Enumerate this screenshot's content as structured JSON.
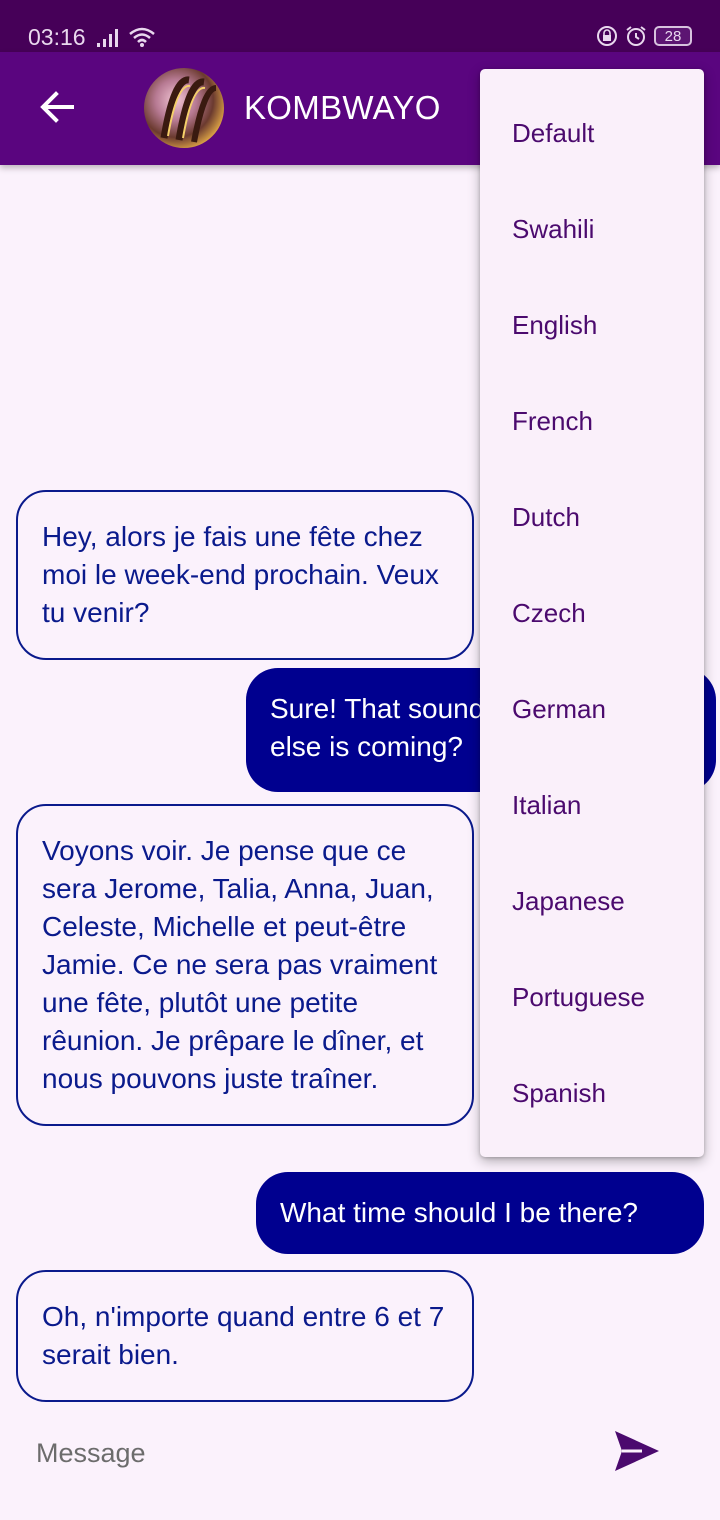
{
  "status_bar": {
    "time": "03:16",
    "battery": "28"
  },
  "header": {
    "contact_name": "KOMBWAYO"
  },
  "messages": [
    {
      "side": "incoming",
      "text": "Hey, alors je fais une fête chez moi le week-end prochain. Veux tu venir?"
    },
    {
      "side": "outgoing",
      "text": "Sure! That sounds great. Who else is coming?"
    },
    {
      "side": "incoming",
      "text": "Voyons voir. Je pense que ce sera Jerome, Talia, Anna, Juan, Celeste, Michelle et peut-être Jamie. Ce ne sera pas vraiment une fête, plutôt une petite rêunion. Je prêpare le dîner, et nous pouvons juste traîner."
    },
    {
      "side": "outgoing",
      "text": "What time should I be there?"
    },
    {
      "side": "incoming",
      "text": "Oh, n'importe quand entre 6 et 7 serait bien."
    }
  ],
  "composer": {
    "placeholder": "Message"
  },
  "language_menu": {
    "items": [
      "Default",
      "Swahili",
      "English",
      "French",
      "Dutch",
      "Czech",
      "German",
      "Italian",
      "Japanese",
      "Portuguese",
      "Spanish"
    ]
  },
  "colors": {
    "status_bar": "#460058",
    "app_bar": "#5a057f",
    "incoming_text": "#0a1a8c",
    "outgoing_bubble": "#00008f",
    "menu_text": "#4b0a6e",
    "send_icon": "#4b0a6e"
  },
  "icons": {
    "back": "arrow-left-icon",
    "send": "send-icon",
    "signal": "signal-icon",
    "wifi": "wifi-icon",
    "lock": "lock-icon",
    "alarm": "alarm-icon"
  }
}
